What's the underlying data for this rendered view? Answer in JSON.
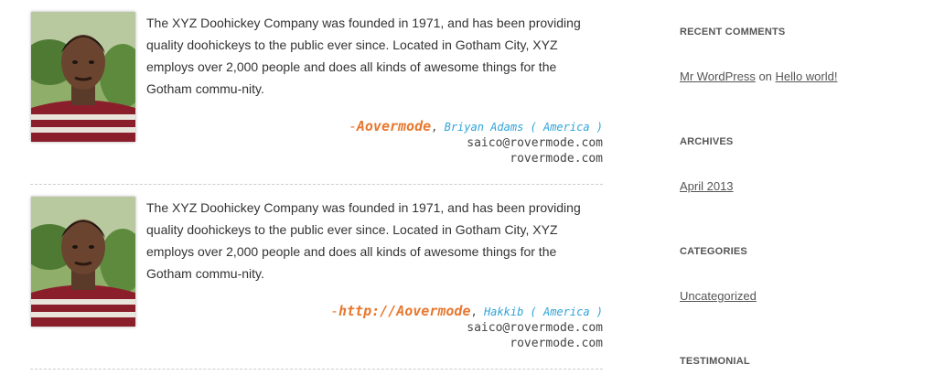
{
  "testimonials": [
    {
      "quote": "The XYZ Doohickey Company was founded in 1971, and has been providing quality doohickeys to the public ever since. Located in Gotham City, XYZ employs over 2,000 people and does all kinds of awesome things for the Gotham commu-nity.",
      "dash": "-",
      "author": "Aovermode",
      "person": "Briyan Adams ( America )",
      "email": "saico@rovermode.com",
      "website": "rovermode.com",
      "photo_icon": "person-photo"
    },
    {
      "quote": "The XYZ Doohickey Company was founded in 1971, and has been providing quality doohickeys to the public ever since. Located in Gotham City, XYZ employs over 2,000 people and does all kinds of awesome things for the Gotham commu-nity.",
      "dash": "-",
      "author": "http://Aovermode",
      "person": "Hakkib ( America )",
      "email": "saico@rovermode.com",
      "website": "rovermode.com",
      "photo_icon": "person-photo"
    }
  ],
  "sidebar": {
    "recent_comments": {
      "title": "RECENT COMMENTS",
      "commenter": "Mr WordPress",
      "on": "on",
      "post": "Hello world!"
    },
    "archives": {
      "title": "ARCHIVES",
      "items": [
        "April 2013"
      ]
    },
    "categories": {
      "title": "CATEGORIES",
      "items": [
        "Uncategorized"
      ]
    },
    "testimonial": {
      "title": "TESTIMONIAL"
    }
  },
  "colors": {
    "author": "#e8772e",
    "person": "#2fa4d8",
    "text": "#333333",
    "divider": "#cccccc"
  }
}
